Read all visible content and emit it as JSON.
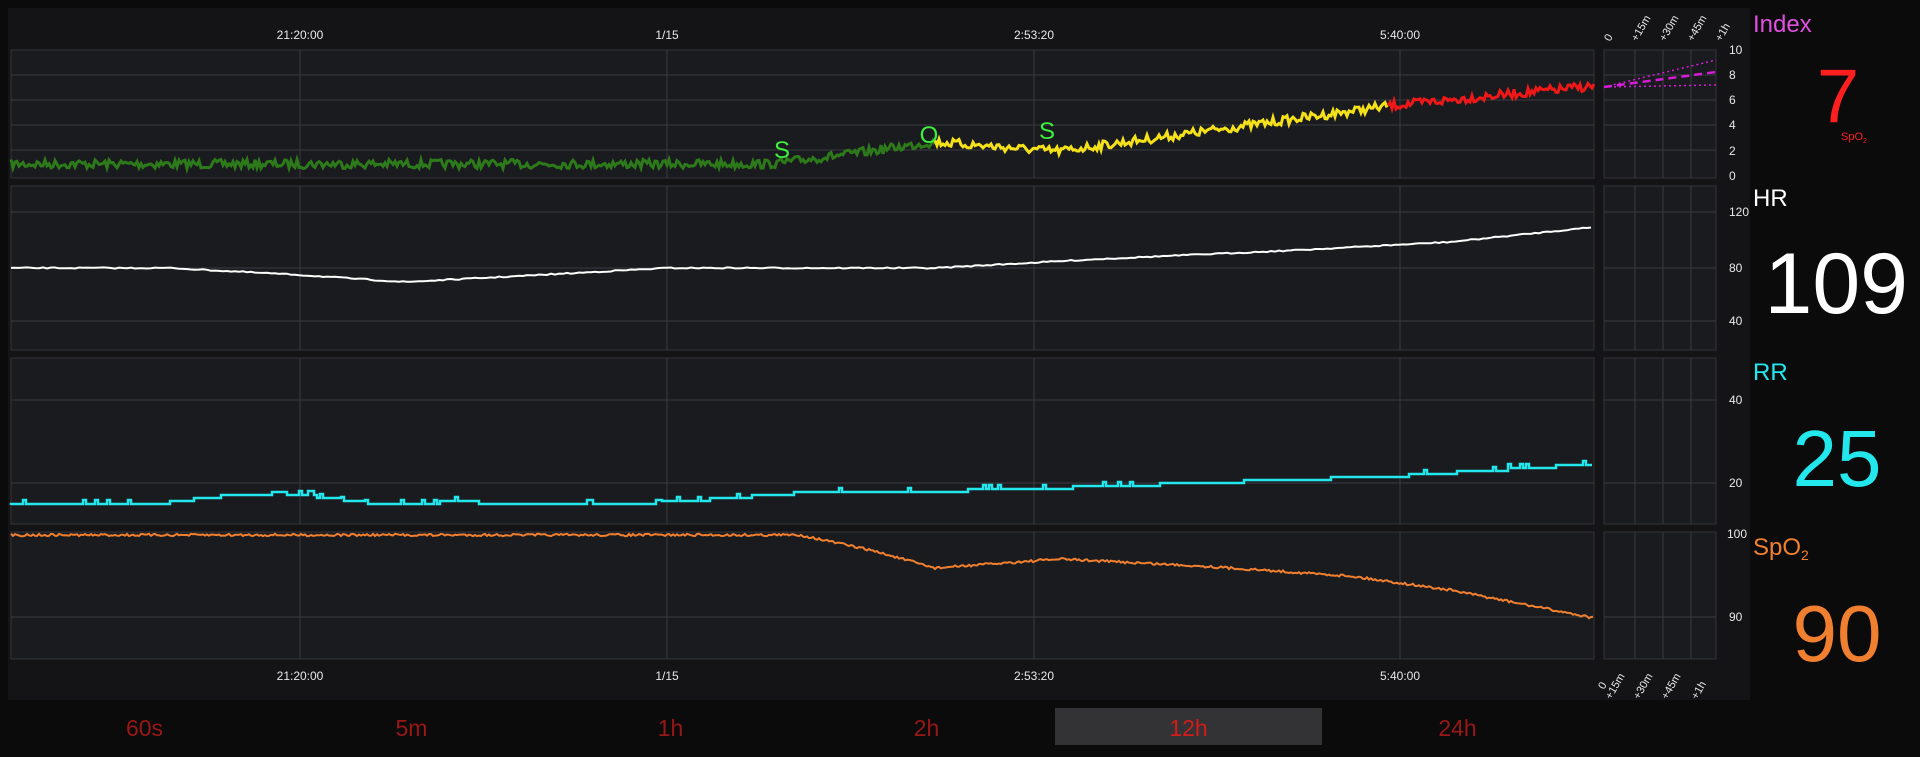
{
  "time_axis": {
    "top_labels": [
      "21:20:00",
      "1/15",
      "2:53:20",
      "5:40:00"
    ],
    "bottom_labels": [
      "21:20:00",
      "1/15",
      "2:53:20",
      "5:40:00"
    ]
  },
  "forecast_axis": {
    "labels": [
      "0",
      "+15m",
      "+30m",
      "+45m",
      "+1h"
    ]
  },
  "index_panel": {
    "label": "Index",
    "value": "7",
    "subscript": "SpO",
    "subscript_sub": "2",
    "label_color": "#e050e0",
    "value_color": "#ff1f1f",
    "y_ticks": [
      "10",
      "8",
      "6",
      "4",
      "2",
      "0"
    ],
    "markers": [
      "S",
      "O",
      "S"
    ]
  },
  "hr_panel": {
    "label": "HR",
    "value": "109",
    "color": "#ffffff",
    "y_ticks": [
      "120",
      "80",
      "40"
    ]
  },
  "rr_panel": {
    "label": "RR",
    "value": "25",
    "color": "#22e8ee",
    "y_ticks": [
      "40",
      "20"
    ]
  },
  "spo2_panel": {
    "label": "SpO",
    "label_sub": "2",
    "value": "90",
    "color": "#f08030",
    "y_ticks": [
      "100",
      "90"
    ]
  },
  "time_ranges": {
    "items": [
      "60s",
      "5m",
      "1h",
      "2h",
      "12h",
      "24h"
    ],
    "active": "12h"
  },
  "colors": {
    "panel_bg": "#1a1b1f",
    "grid": "#3a3b40",
    "index_green": "#2d7a1a",
    "index_yellow": "#f5e11a",
    "index_red": "#ee1818",
    "forecast_magenta": "#d81bd8",
    "marker_green": "#3df03d"
  }
}
